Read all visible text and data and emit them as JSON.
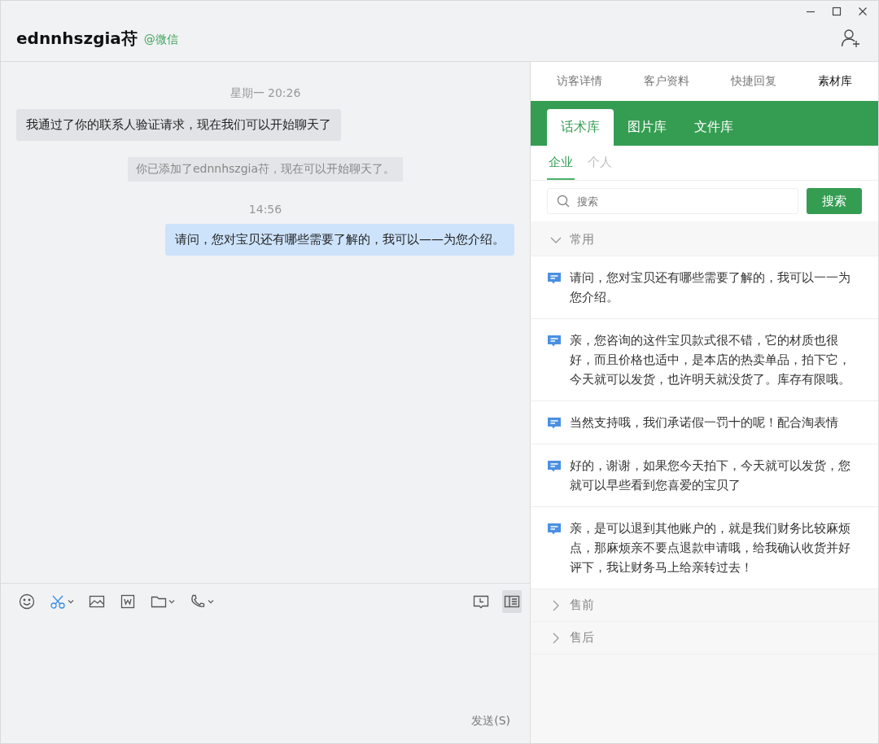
{
  "header": {
    "title": "ednnhszgia苻",
    "source": "@微信"
  },
  "messages": [
    {
      "kind": "time",
      "text": "星期一 20:26"
    },
    {
      "kind": "received",
      "text": "我通过了你的联系人验证请求，现在我们可以开始聊天了"
    },
    {
      "kind": "system",
      "text": "你已添加了ednnhszgia苻，现在可以开始聊天了。"
    },
    {
      "kind": "time",
      "text": "14:56"
    },
    {
      "kind": "sent",
      "text": "请问，您对宝贝还有哪些需要了解的，我可以——为您介绍。"
    }
  ],
  "toolbar": {
    "left": [
      {
        "kind": "emoji",
        "menu": false
      },
      {
        "kind": "scissors",
        "menu": true
      },
      {
        "kind": "image",
        "menu": false
      },
      {
        "kind": "word",
        "menu": false
      },
      {
        "kind": "folder",
        "menu": true
      },
      {
        "kind": "phone",
        "menu": true
      }
    ],
    "right": [
      {
        "kind": "history",
        "selected": false
      },
      {
        "kind": "sidebar",
        "selected": true
      }
    ]
  },
  "send_button": "发送(S)",
  "side_tabs": [
    {
      "label": "访客详情",
      "selected": false
    },
    {
      "label": "客户资料",
      "selected": false
    },
    {
      "label": "快捷回复",
      "selected": false
    },
    {
      "label": "素材库",
      "selected": true
    }
  ],
  "library_tabs": [
    {
      "label": "话术库",
      "selected": true
    },
    {
      "label": "图片库",
      "selected": false
    },
    {
      "label": "文件库",
      "selected": false
    }
  ],
  "scope_tabs": [
    {
      "label": "企业",
      "selected": true
    },
    {
      "label": "个人",
      "selected": false
    }
  ],
  "search": {
    "placeholder": "搜索",
    "button": "搜索"
  },
  "groups": [
    {
      "title": "常用",
      "expanded": true,
      "items": [
        "请问，您对宝贝还有哪些需要了解的，我可以一一为您介绍。",
        "亲，您咨询的这件宝贝款式很不错，它的材质也很好，而且价格也适中，是本店的热卖单品，拍下它，今天就可以发货，也许明天就没货了。库存有限哦。",
        "当然支持哦，我们承诺假一罚十的呢！配合淘表情",
        "好的，谢谢，如果您今天拍下，今天就可以发货，您就可以早些看到您喜爱的宝贝了",
        "亲，是可以退到其他账户的，就是我们财务比较麻烦点，那麻烦亲不要点退款申请哦，给我确认收货并好评下，我让财务马上给亲转过去！"
      ]
    },
    {
      "title": "售前",
      "expanded": false
    },
    {
      "title": "售后",
      "expanded": false
    }
  ]
}
